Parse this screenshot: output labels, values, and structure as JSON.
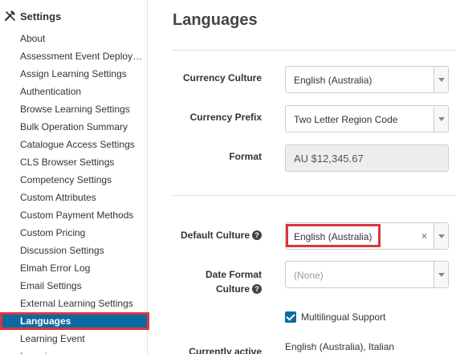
{
  "sidebar": {
    "header": {
      "icon": "wrench-icon",
      "title": "Settings"
    },
    "items": [
      {
        "label": "About"
      },
      {
        "label": "Assessment Event Deployment Settings"
      },
      {
        "label": "Assign Learning Settings"
      },
      {
        "label": "Authentication"
      },
      {
        "label": "Browse Learning Settings"
      },
      {
        "label": "Bulk Operation Summary"
      },
      {
        "label": "Catalogue Access Settings"
      },
      {
        "label": "CLS Browser Settings"
      },
      {
        "label": "Competency Settings"
      },
      {
        "label": "Custom Attributes"
      },
      {
        "label": "Custom Payment Methods"
      },
      {
        "label": "Custom Pricing"
      },
      {
        "label": "Discussion Settings"
      },
      {
        "label": "Elmah Error Log"
      },
      {
        "label": "Email Settings"
      },
      {
        "label": "External Learning Settings"
      },
      {
        "label": "Languages"
      },
      {
        "label": "Learning Event"
      },
      {
        "label": "Learning..."
      }
    ],
    "active_index": 16
  },
  "main": {
    "title": "Languages",
    "currency_culture": {
      "label": "Currency Culture",
      "value": "English (Australia)"
    },
    "currency_prefix": {
      "label": "Currency Prefix",
      "value": "Two Letter Region Code"
    },
    "format": {
      "label": "Format",
      "value": "AU $12,345.67"
    },
    "default_culture": {
      "label": "Default Culture",
      "value": "English (Australia)",
      "clear": "×"
    },
    "date_format_culture": {
      "label_line1": "Date Format",
      "label_line2": "Culture",
      "placeholder": "(None)"
    },
    "multilingual": {
      "label": "Multilingual Support",
      "checked": true
    },
    "currently_active": {
      "label": "Currently active",
      "value": "English (Australia), Italian"
    }
  },
  "colors": {
    "accent": "#0a6aa1",
    "highlight": "#d9363e"
  }
}
